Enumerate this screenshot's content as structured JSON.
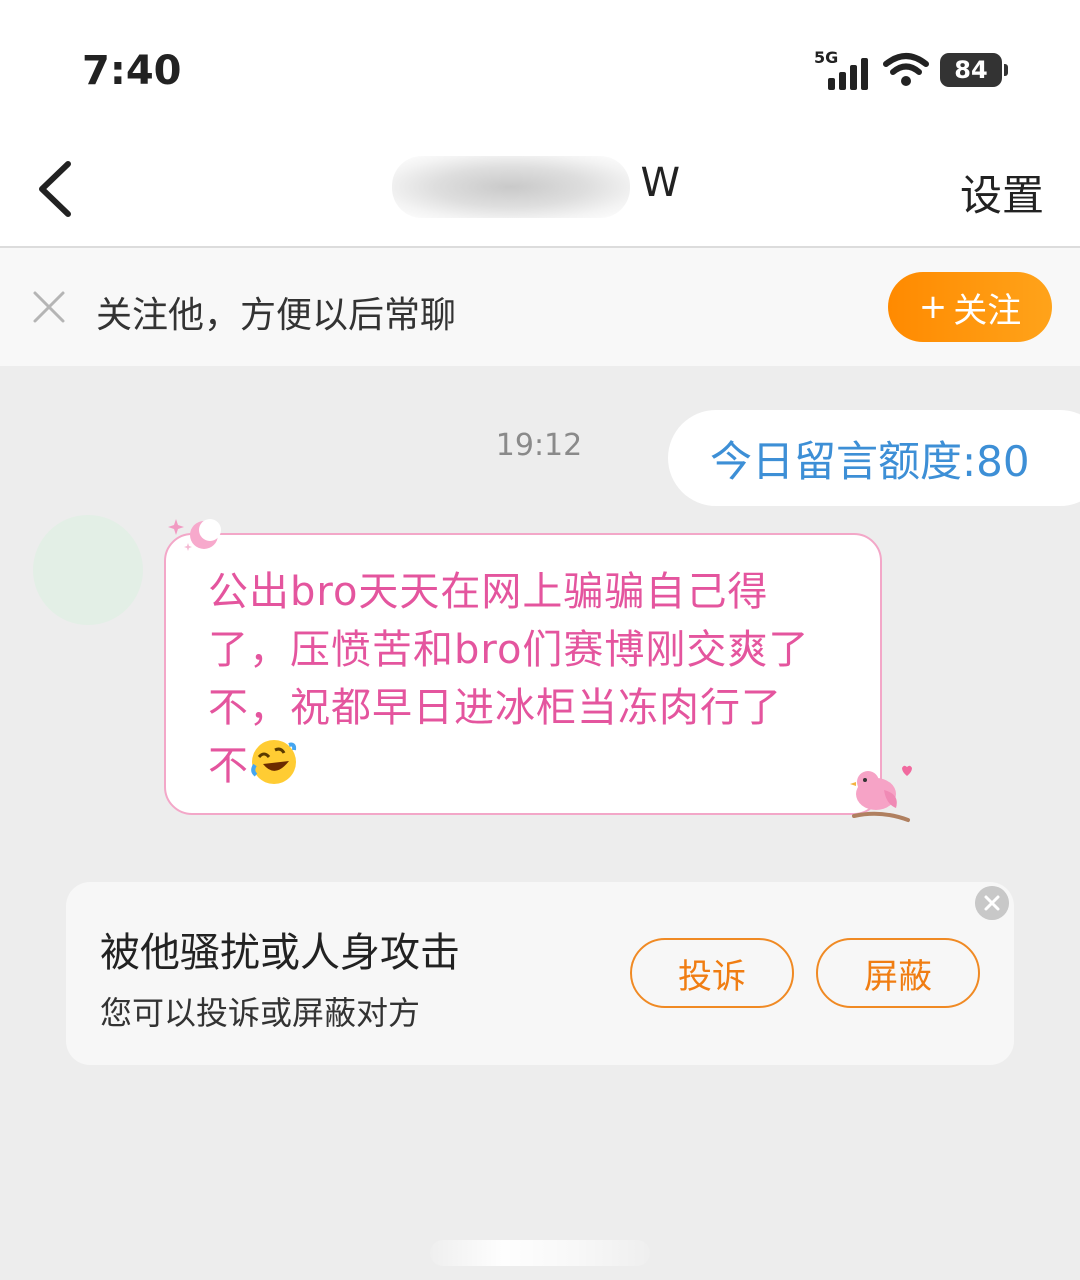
{
  "status_bar": {
    "time": "7:40",
    "network": "5G",
    "battery": "84"
  },
  "nav": {
    "title_visible": "W",
    "settings_label": "设置",
    "back_icon": "chevron-left-icon"
  },
  "follow_bar": {
    "text": "关注他，方便以后常聊",
    "button_label": "关注",
    "button_plus": "+"
  },
  "chat": {
    "timestamp": "19:12",
    "quota_text": "今日留言额度:80",
    "message_lines": [
      "公出bro天天在网上骗骗自己得",
      "了，压愤苦和bro们赛博刚交爽了",
      "不，祝都早日进冰柜当冻肉行了",
      "不"
    ],
    "message_emoji": "rolling-on-floor-laughing"
  },
  "report_card": {
    "title": "被他骚扰或人身攻击",
    "subtitle": "您可以投诉或屏蔽对方",
    "complain_label": "投诉",
    "block_label": "屏蔽"
  },
  "colors": {
    "accent_orange": "#ff8a00",
    "message_pink": "#e4559e",
    "quota_blue": "#3d8fd6",
    "background": "#ededed"
  }
}
